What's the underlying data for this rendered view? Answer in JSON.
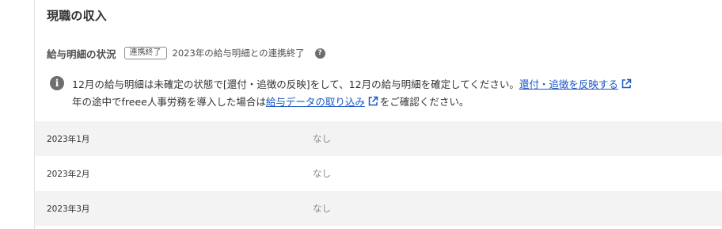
{
  "section": {
    "title": "現職の収入"
  },
  "status": {
    "label": "給与明細の状況",
    "badge": "連携終了",
    "text": "2023年の給与明細との連携終了",
    "help_icon": "question-circle-icon"
  },
  "notice": {
    "icon": "info-circle-icon",
    "line1_text": "12月の給与明細は未確定の状態で[還付・追徴の反映]をして、12月の給与明細を確定してください。",
    "line1_link": "還付・追徴を反映する",
    "line2_text_before": "年の途中でfreee人事労務を導入した場合は",
    "line2_link": "給与データの取り込み",
    "line2_text_after": "をご確認ください。",
    "link_color": "#1a56c7"
  },
  "table": {
    "rows": [
      {
        "month": "2023年1月",
        "value": "なし"
      },
      {
        "month": "2023年2月",
        "value": "なし"
      },
      {
        "month": "2023年3月",
        "value": "なし"
      }
    ]
  }
}
